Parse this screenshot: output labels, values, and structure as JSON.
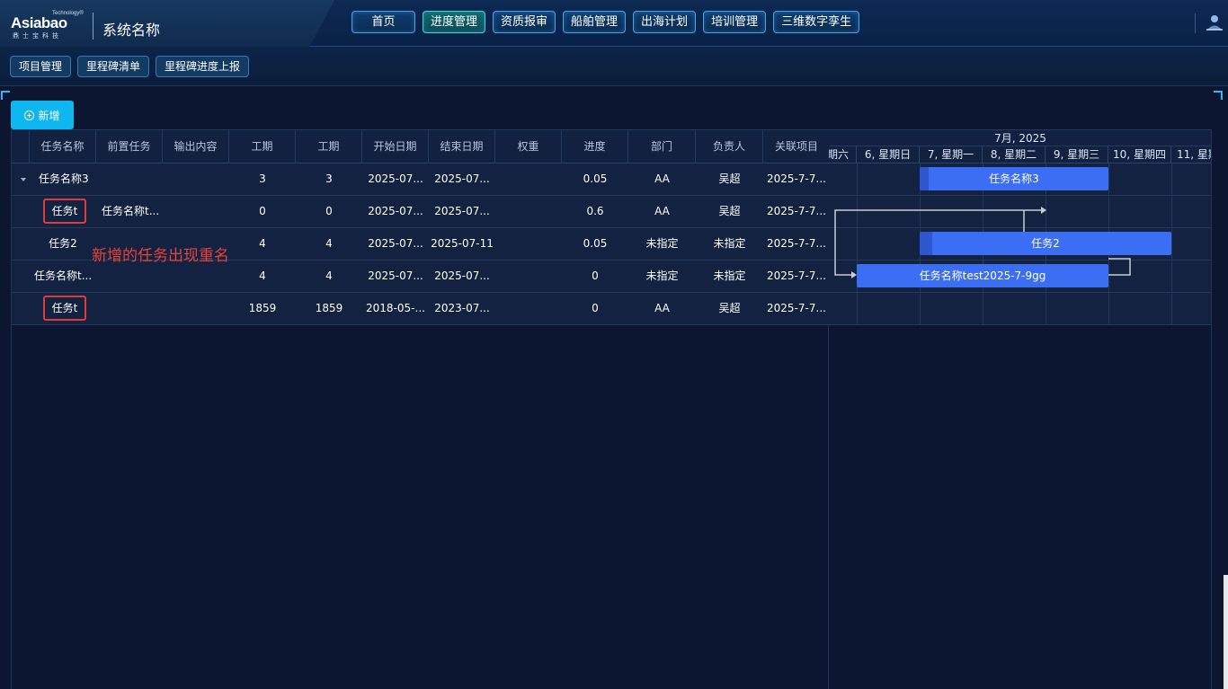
{
  "header": {
    "logo": {
      "main": "Asiabao",
      "sup": "Technology®",
      "sub": "鼎士宝科技"
    },
    "system_name": "系统名称",
    "nav": [
      "首页",
      "进度管理",
      "资质报审",
      "船舶管理",
      "出海计划",
      "培训管理",
      "三维数字孪生"
    ],
    "active_nav": "进度管理",
    "user_icon": "user-avatar-icon"
  },
  "subnav": [
    "项目管理",
    "里程碑清单",
    "里程碑进度上报"
  ],
  "toolbar": {
    "add_label": "新增",
    "add_icon": "plus-circle-icon"
  },
  "grid": {
    "columns": [
      "任务名称",
      "前置任务",
      "输出内容",
      "工期",
      "工期",
      "开始日期",
      "结束日期",
      "权重",
      "进度",
      "部门",
      "负责人",
      "关联项目"
    ],
    "rows": [
      {
        "name": "任务名称3",
        "pre": "",
        "output": "",
        "d1": "3",
        "d2": "3",
        "start": "2025-07...",
        "end": "2025-07...",
        "weight": "",
        "progress": "0.05",
        "dept": "AA",
        "owner": "吴超",
        "project": "2025-7-7..."
      },
      {
        "name": "任务t",
        "pre": "任务名称t...",
        "output": "",
        "d1": "0",
        "d2": "0",
        "start": "2025-07...",
        "end": "2025-07...",
        "weight": "",
        "progress": "0.6",
        "dept": "AA",
        "owner": "吴超",
        "project": "2025-7-7..."
      },
      {
        "name": "任务2",
        "pre": "",
        "output": "",
        "d1": "4",
        "d2": "4",
        "start": "2025-07...",
        "end": "2025-07-11",
        "weight": "",
        "progress": "0.05",
        "dept": "未指定",
        "owner": "未指定",
        "project": "2025-7-7..."
      },
      {
        "name": "任务名称t...",
        "pre": "",
        "output": "",
        "d1": "4",
        "d2": "4",
        "start": "2025-07...",
        "end": "2025-07...",
        "weight": "",
        "progress": "0",
        "dept": "未指定",
        "owner": "未指定",
        "project": "2025-7-7..."
      },
      {
        "name": "任务t",
        "pre": "",
        "output": "",
        "d1": "1859",
        "d2": "1859",
        "start": "2018-05-...",
        "end": "2023-07...",
        "weight": "",
        "progress": "0",
        "dept": "AA",
        "owner": "吴超",
        "project": "2025-7-7..."
      }
    ],
    "annotation": "新增的任务出现重名"
  },
  "gantt": {
    "month": "7月, 2025",
    "days": [
      "期六",
      "6, 星期日",
      "7, 星期一",
      "8, 星期二",
      "9, 星期三",
      "10, 星期四",
      "11, 星期"
    ],
    "bars": [
      {
        "label": "任务名称3",
        "progress": 0.05
      },
      {
        "label": "任务2",
        "progress": 0.05
      },
      {
        "label": "任务名称test2025-7-9gg",
        "progress": 0
      }
    ]
  },
  "colors": {
    "accent": "#0fb6f0",
    "bar": "#3b6ef2",
    "highlight": "#e03a3a",
    "background": "#0d1630"
  }
}
